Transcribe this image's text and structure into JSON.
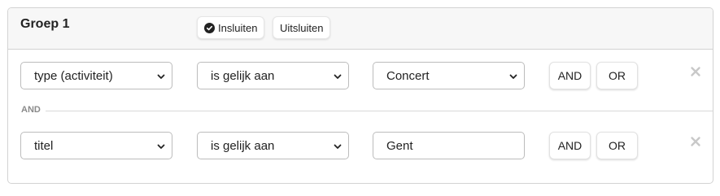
{
  "group": {
    "title": "Groep 1",
    "include_label": "Insluiten",
    "exclude_label": "Uitsluiten"
  },
  "rows": [
    {
      "field": "type (activiteit)",
      "operator": "is gelijk aan",
      "value": "Concert",
      "value_is_select": true,
      "and_label": "AND",
      "or_label": "OR"
    },
    {
      "field": "titel",
      "operator": "is gelijk aan",
      "value": "Gent",
      "value_is_select": false,
      "and_label": "AND",
      "or_label": "OR"
    }
  ],
  "divider_label": "AND",
  "icons": {
    "include": "check-circle-icon",
    "chevron": "chevron-down-icon",
    "remove": "close-icon"
  },
  "colors": {
    "header_bg": "#f7f7f7",
    "border": "#d3d3d3",
    "remove_icon": "#c8c8c8"
  }
}
